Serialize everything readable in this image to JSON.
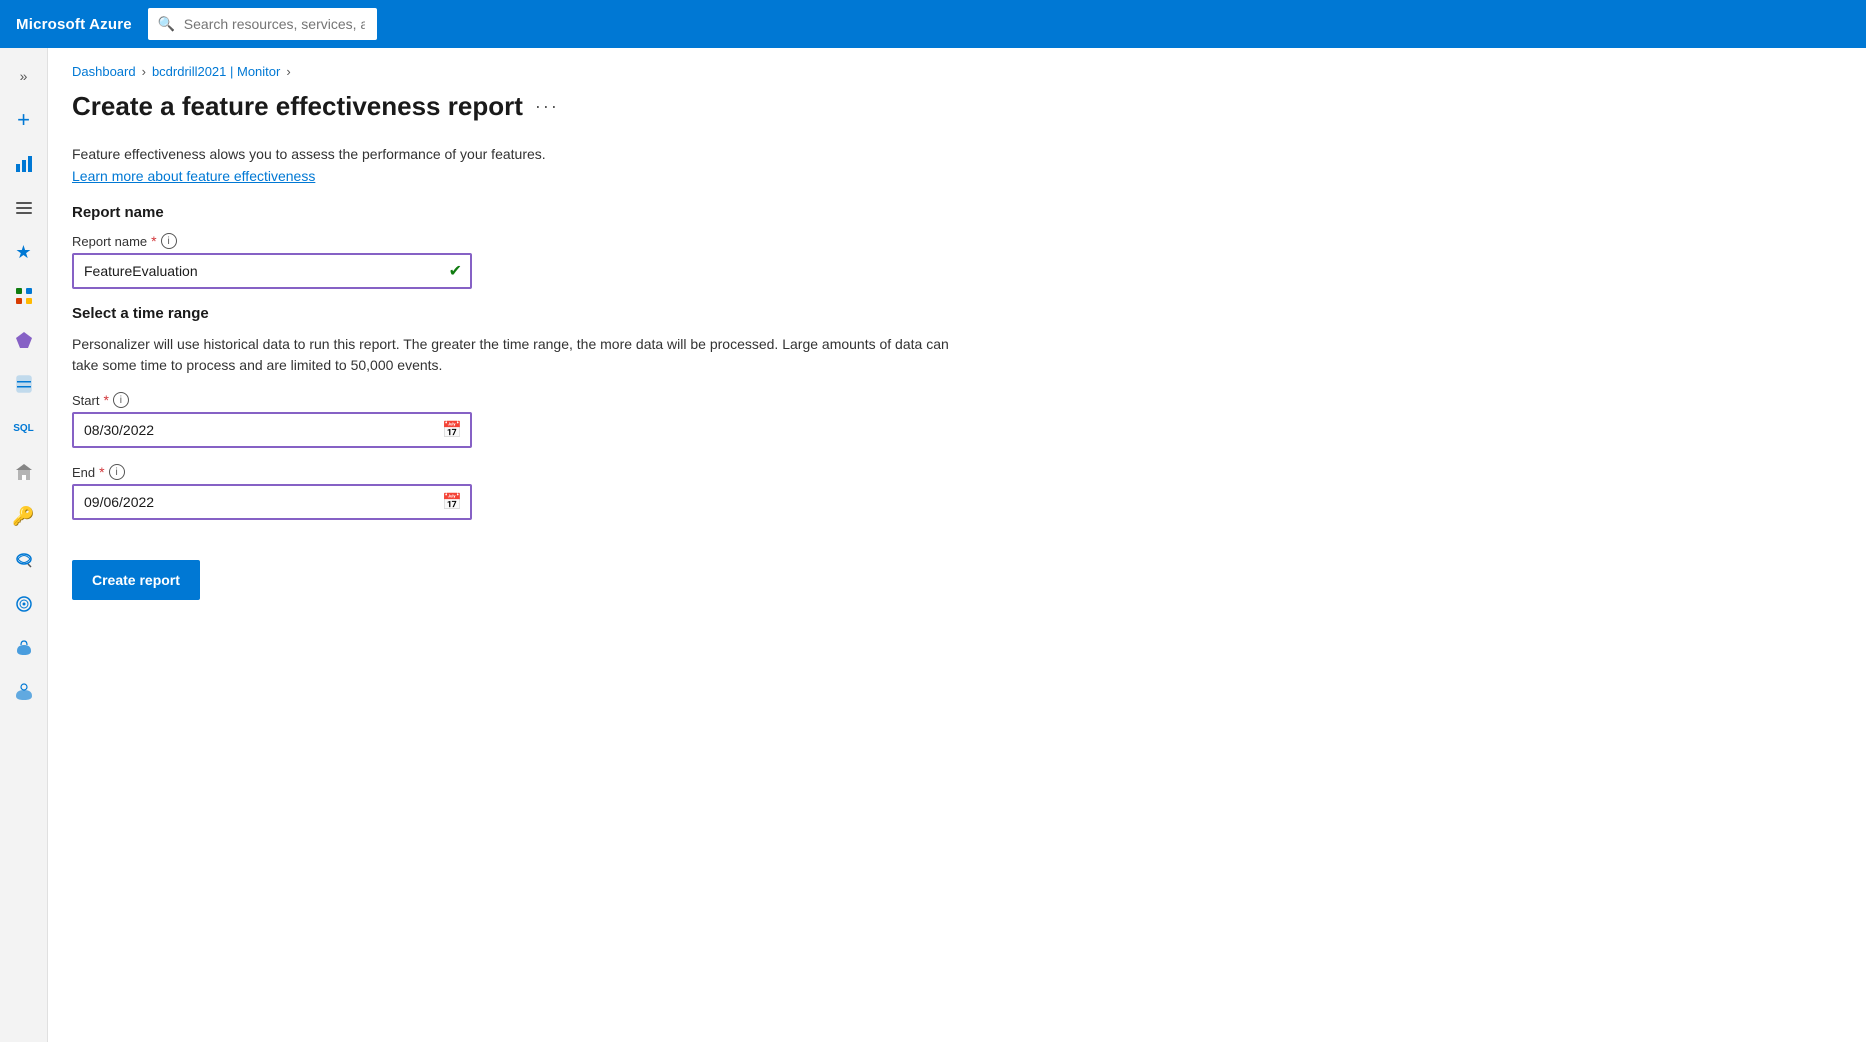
{
  "topbar": {
    "brand": "Microsoft Azure",
    "search_placeholder": "Search resources, services, and docs (G+/)"
  },
  "breadcrumb": {
    "items": [
      {
        "label": "Dashboard",
        "link": true
      },
      {
        "label": "bcdrdrill2021 | Monitor",
        "link": true
      }
    ],
    "separators": [
      ">",
      ">"
    ]
  },
  "page": {
    "title": "Create a feature effectiveness report",
    "menu_icon": "···",
    "description": "Feature effectiveness alows you to assess the performance of your features.",
    "learn_more_label": "Learn more about feature effectiveness"
  },
  "report_name_section": {
    "title": "Report name",
    "field_label": "Report name",
    "required": "*",
    "value": "FeatureEvaluation"
  },
  "time_range_section": {
    "title": "Select a time range",
    "description": "Personalizer will use historical data to run this report. The greater the time range, the more data will be processed. Large amounts of data can take some time to process and are limited to 50,000 events.",
    "start_label": "Start",
    "start_required": "*",
    "start_value": "08/30/2022",
    "end_label": "End",
    "end_required": "*",
    "end_value": "09/06/2022"
  },
  "actions": {
    "create_report": "Create report"
  },
  "sidebar": {
    "items": [
      {
        "name": "expand",
        "icon": "»"
      },
      {
        "name": "add",
        "icon": "+"
      },
      {
        "name": "chart",
        "icon": "📊"
      },
      {
        "name": "list",
        "icon": "≡"
      },
      {
        "name": "favorites",
        "icon": "★"
      },
      {
        "name": "grid",
        "icon": "⊞"
      },
      {
        "name": "gem",
        "icon": "💎"
      },
      {
        "name": "database",
        "icon": "🗃"
      },
      {
        "name": "sql",
        "icon": "SQL"
      },
      {
        "name": "building",
        "icon": "🏢"
      },
      {
        "name": "key",
        "icon": "🔑"
      },
      {
        "name": "cloud-search",
        "icon": "☁"
      },
      {
        "name": "satellite",
        "icon": "📡"
      },
      {
        "name": "cloud-globe",
        "icon": "🌐"
      },
      {
        "name": "cloud-connect",
        "icon": "☁"
      }
    ]
  }
}
